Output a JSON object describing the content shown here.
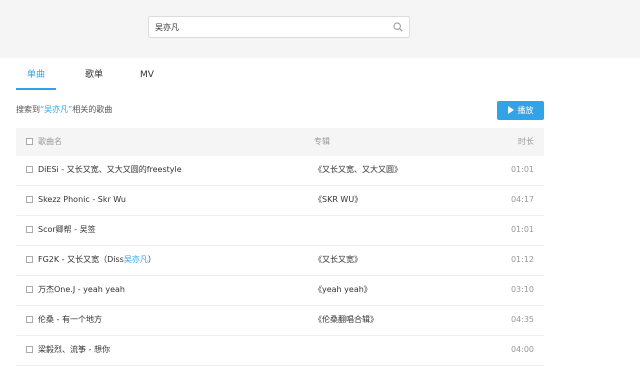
{
  "search": {
    "value": "吴亦凡",
    "placeholder": ""
  },
  "tabs": [
    {
      "label": "单曲",
      "active": true
    },
    {
      "label": "歌单",
      "active": false
    },
    {
      "label": "MV",
      "active": false
    }
  ],
  "result": {
    "prefix": "搜索到",
    "keyword": "“吴亦凡”",
    "suffix": "相关的歌曲"
  },
  "play_button": {
    "label": "播放",
    "icon": "play-icon"
  },
  "table": {
    "headers": {
      "name": "歌曲名",
      "album": "专辑",
      "duration": "时长"
    },
    "rows": [
      {
        "name": "DiESi - 又长又宽、又大又圆的freestyle",
        "album": "《又长又宽、又大又圆》",
        "duration": "01:01"
      },
      {
        "name": "Skezz Phonic - Skr Wu",
        "album": "《SKR WU》",
        "duration": "04:17"
      },
      {
        "name": "Scor卿帮 - 吴签",
        "album": "",
        "duration": "01:01"
      },
      {
        "name_before": "FG2K - 又长又宽（Diss",
        "name_highlight": "吴亦凡",
        "name_after": "）",
        "album": "《又长又宽》",
        "duration": "01:12"
      },
      {
        "name": "万杰One.J - yeah yeah",
        "album": "《yeah yeah》",
        "duration": "03:10"
      },
      {
        "name": "伦桑 - 有一个地方",
        "album": "《伦桑翻唱合辑》",
        "duration": "04:35"
      },
      {
        "name": "梁毅烈、流筝 - 想你",
        "album": "",
        "duration": "04:00"
      }
    ]
  },
  "colors": {
    "accent": "#31a3e6",
    "topbar": "#f5f5f5",
    "header": "#f5f5f5"
  }
}
